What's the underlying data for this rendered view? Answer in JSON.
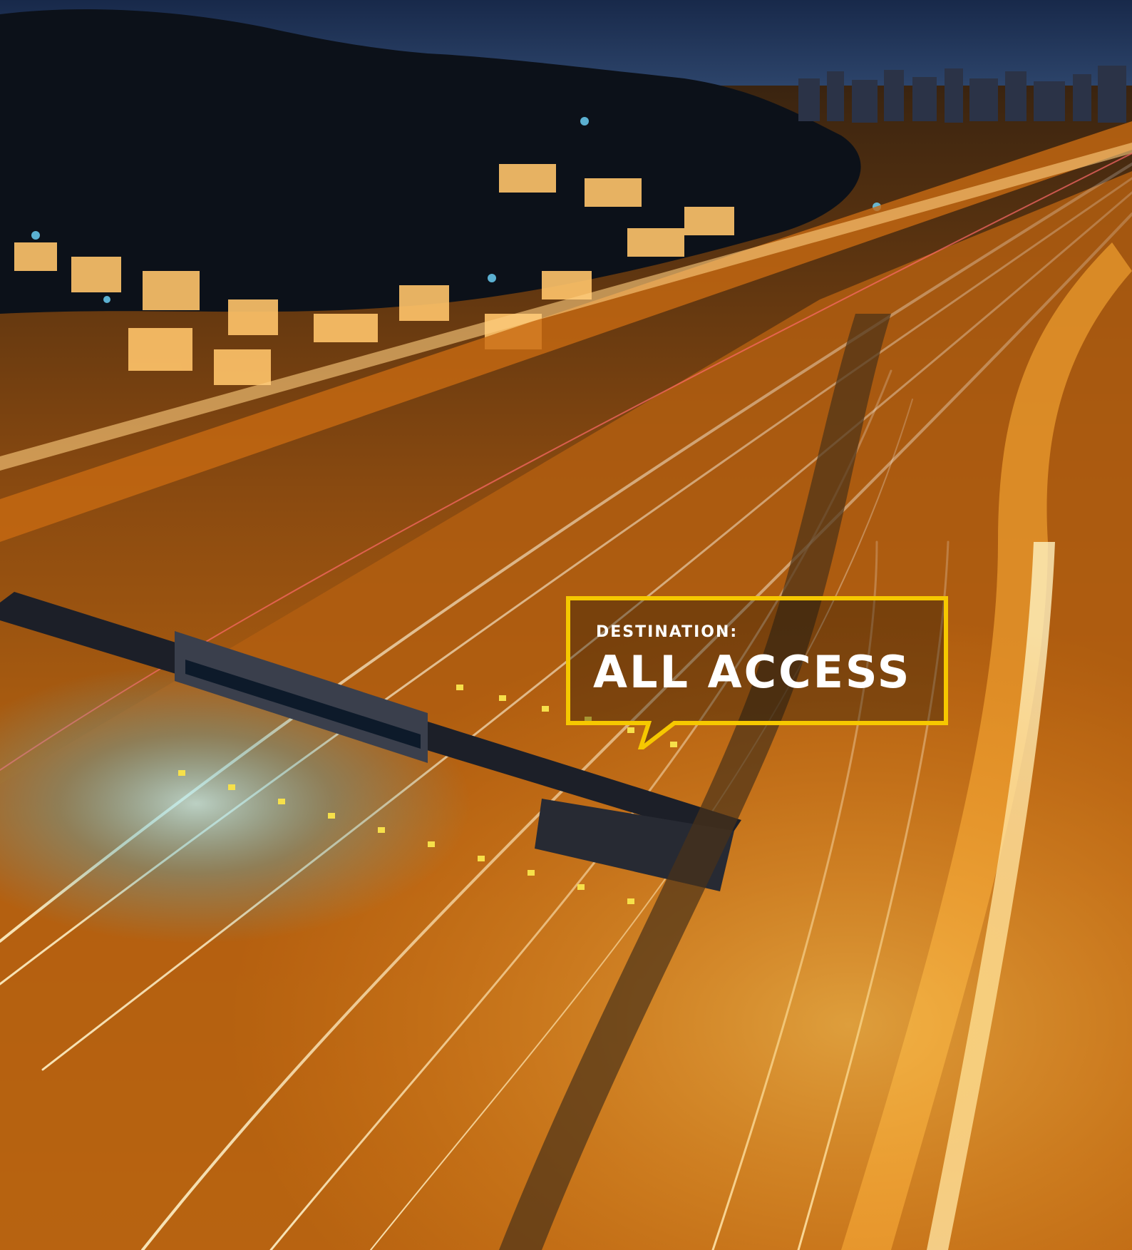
{
  "photo": {
    "subject": "aerial night view of a highway toll plaza with light trails",
    "palette": {
      "sky_top": "#1c2f55",
      "sky_horizon": "#34507a",
      "hills": "#0e1420",
      "city_glow": "#ff8a1c",
      "road_glow": "#ffb020",
      "toll_light": "#7fe8ff"
    }
  },
  "callout": {
    "kicker": "DESTINATION:",
    "title": "ALL ACCESS",
    "border_color": "#f6c800"
  }
}
